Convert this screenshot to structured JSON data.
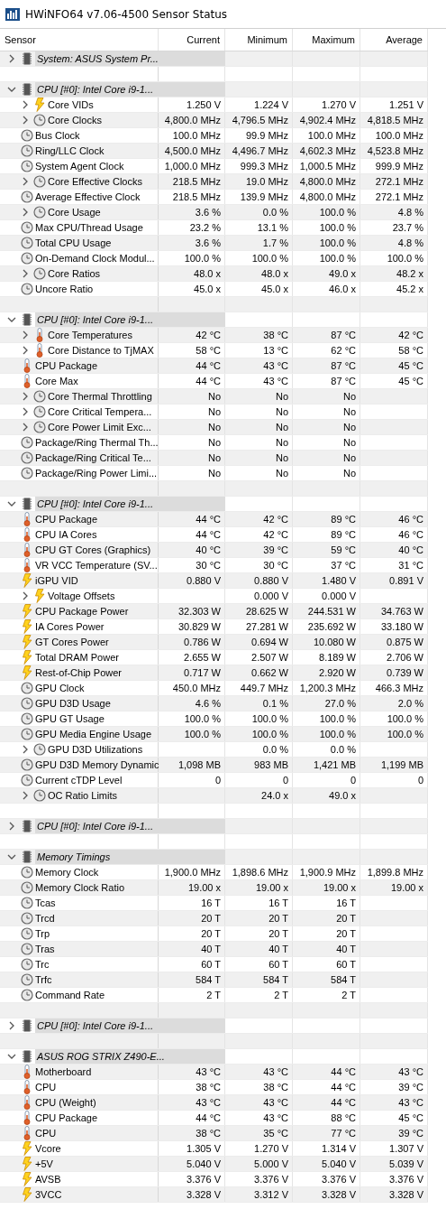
{
  "window": {
    "title": "HWiNFO64 v7.06-4500 Sensor Status"
  },
  "columns": [
    "Sensor",
    "Current",
    "Minimum",
    "Maximum",
    "Average"
  ],
  "groups": [
    {
      "label": "System: ASUS System Pr...",
      "expanded": false
    },
    {
      "label": "CPU [#0]: Intel Core i9-1...",
      "expanded": true,
      "rows": [
        {
          "name": "Core VIDs",
          "kind": "voltage",
          "expandable": true,
          "current": "1.250 V",
          "minimum": "1.224 V",
          "maximum": "1.270 V",
          "average": "1.251 V"
        },
        {
          "name": "Core Clocks",
          "kind": "clock",
          "expandable": true,
          "current": "4,800.0 MHz",
          "minimum": "4,796.5 MHz",
          "maximum": "4,902.4 MHz",
          "average": "4,818.5 MHz"
        },
        {
          "name": "Bus Clock",
          "kind": "clock",
          "expandable": false,
          "current": "100.0 MHz",
          "minimum": "99.9 MHz",
          "maximum": "100.0 MHz",
          "average": "100.0 MHz"
        },
        {
          "name": "Ring/LLC Clock",
          "kind": "clock",
          "expandable": false,
          "current": "4,500.0 MHz",
          "minimum": "4,496.7 MHz",
          "maximum": "4,602.3 MHz",
          "average": "4,523.8 MHz"
        },
        {
          "name": "System Agent Clock",
          "kind": "clock",
          "expandable": false,
          "current": "1,000.0 MHz",
          "minimum": "999.3 MHz",
          "maximum": "1,000.5 MHz",
          "average": "999.9 MHz"
        },
        {
          "name": "Core Effective Clocks",
          "kind": "clock",
          "expandable": true,
          "current": "218.5 MHz",
          "minimum": "19.0 MHz",
          "maximum": "4,800.0 MHz",
          "average": "272.1 MHz"
        },
        {
          "name": "Average Effective Clock",
          "kind": "clock",
          "expandable": false,
          "current": "218.5 MHz",
          "minimum": "139.9 MHz",
          "maximum": "4,800.0 MHz",
          "average": "272.1 MHz"
        },
        {
          "name": "Core Usage",
          "kind": "clock",
          "expandable": true,
          "current": "3.6 %",
          "minimum": "0.0 %",
          "maximum": "100.0 %",
          "average": "4.8 %"
        },
        {
          "name": "Max CPU/Thread Usage",
          "kind": "clock",
          "expandable": false,
          "current": "23.2 %",
          "minimum": "13.1 %",
          "maximum": "100.0 %",
          "average": "23.7 %"
        },
        {
          "name": "Total CPU Usage",
          "kind": "clock",
          "expandable": false,
          "current": "3.6 %",
          "minimum": "1.7 %",
          "maximum": "100.0 %",
          "average": "4.8 %"
        },
        {
          "name": "On-Demand Clock Modul...",
          "kind": "clock",
          "expandable": false,
          "current": "100.0 %",
          "minimum": "100.0 %",
          "maximum": "100.0 %",
          "average": "100.0 %"
        },
        {
          "name": "Core Ratios",
          "kind": "clock",
          "expandable": true,
          "current": "48.0 x",
          "minimum": "48.0 x",
          "maximum": "49.0 x",
          "average": "48.2 x"
        },
        {
          "name": "Uncore Ratio",
          "kind": "clock",
          "expandable": false,
          "current": "45.0 x",
          "minimum": "45.0 x",
          "maximum": "46.0 x",
          "average": "45.2 x"
        }
      ]
    },
    {
      "label": "CPU [#0]: Intel Core i9-1...",
      "expanded": true,
      "rows": [
        {
          "name": "Core Temperatures",
          "kind": "temperature",
          "expandable": true,
          "current": "42 °C",
          "minimum": "38 °C",
          "maximum": "87 °C",
          "average": "42 °C"
        },
        {
          "name": "Core Distance to TjMAX",
          "kind": "temperature",
          "expandable": true,
          "current": "58 °C",
          "minimum": "13 °C",
          "maximum": "62 °C",
          "average": "58 °C"
        },
        {
          "name": "CPU Package",
          "kind": "temperature",
          "expandable": false,
          "current": "44 °C",
          "minimum": "43 °C",
          "maximum": "87 °C",
          "average": "45 °C"
        },
        {
          "name": "Core Max",
          "kind": "temperature",
          "expandable": false,
          "current": "44 °C",
          "minimum": "43 °C",
          "maximum": "87 °C",
          "average": "45 °C"
        },
        {
          "name": "Core Thermal Throttling",
          "kind": "clock",
          "expandable": true,
          "current": "No",
          "minimum": "No",
          "maximum": "No"
        },
        {
          "name": "Core Critical Tempera...",
          "kind": "clock",
          "expandable": true,
          "current": "No",
          "minimum": "No",
          "maximum": "No"
        },
        {
          "name": "Core Power Limit Exc...",
          "kind": "clock",
          "expandable": true,
          "current": "No",
          "minimum": "No",
          "maximum": "No"
        },
        {
          "name": "Package/Ring Thermal Th...",
          "kind": "clock",
          "expandable": false,
          "current": "No",
          "minimum": "No",
          "maximum": "No"
        },
        {
          "name": "Package/Ring Critical Te...",
          "kind": "clock",
          "expandable": false,
          "current": "No",
          "minimum": "No",
          "maximum": "No"
        },
        {
          "name": "Package/Ring Power Limi...",
          "kind": "clock",
          "expandable": false,
          "current": "No",
          "minimum": "No",
          "maximum": "No"
        }
      ]
    },
    {
      "label": "CPU [#0]: Intel Core i9-1...",
      "expanded": true,
      "rows": [
        {
          "name": "CPU Package",
          "kind": "temperature",
          "expandable": false,
          "current": "44 °C",
          "minimum": "42 °C",
          "maximum": "89 °C",
          "average": "46 °C"
        },
        {
          "name": "CPU IA Cores",
          "kind": "temperature",
          "expandable": false,
          "current": "44 °C",
          "minimum": "42 °C",
          "maximum": "89 °C",
          "average": "46 °C"
        },
        {
          "name": "CPU GT Cores (Graphics)",
          "kind": "temperature",
          "expandable": false,
          "current": "40 °C",
          "minimum": "39 °C",
          "maximum": "59 °C",
          "average": "40 °C"
        },
        {
          "name": "VR VCC Temperature (SV...",
          "kind": "temperature",
          "expandable": false,
          "current": "30 °C",
          "minimum": "30 °C",
          "maximum": "37 °C",
          "average": "31 °C"
        },
        {
          "name": "iGPU VID",
          "kind": "voltage",
          "expandable": false,
          "current": "0.880 V",
          "minimum": "0.880 V",
          "maximum": "1.480 V",
          "average": "0.891 V"
        },
        {
          "name": "Voltage Offsets",
          "kind": "voltage",
          "expandable": true,
          "minimum": "0.000 V",
          "maximum": "0.000 V"
        },
        {
          "name": "CPU Package Power",
          "kind": "voltage",
          "expandable": false,
          "current": "32.303 W",
          "minimum": "28.625 W",
          "maximum": "244.531 W",
          "average": "34.763 W"
        },
        {
          "name": "IA Cores Power",
          "kind": "voltage",
          "expandable": false,
          "current": "30.829 W",
          "minimum": "27.281 W",
          "maximum": "235.692 W",
          "average": "33.180 W"
        },
        {
          "name": "GT Cores Power",
          "kind": "voltage",
          "expandable": false,
          "current": "0.786 W",
          "minimum": "0.694 W",
          "maximum": "10.080 W",
          "average": "0.875 W"
        },
        {
          "name": "Total DRAM Power",
          "kind": "voltage",
          "expandable": false,
          "current": "2.655 W",
          "minimum": "2.507 W",
          "maximum": "8.189 W",
          "average": "2.706 W"
        },
        {
          "name": "Rest-of-Chip Power",
          "kind": "voltage",
          "expandable": false,
          "current": "0.717 W",
          "minimum": "0.662 W",
          "maximum": "2.920 W",
          "average": "0.739 W"
        },
        {
          "name": "GPU Clock",
          "kind": "clock",
          "expandable": false,
          "current": "450.0 MHz",
          "minimum": "449.7 MHz",
          "maximum": "1,200.3 MHz",
          "average": "466.3 MHz"
        },
        {
          "name": "GPU D3D Usage",
          "kind": "clock",
          "expandable": false,
          "current": "4.6 %",
          "minimum": "0.1 %",
          "maximum": "27.0 %",
          "average": "2.0 %"
        },
        {
          "name": "GPU GT Usage",
          "kind": "clock",
          "expandable": false,
          "current": "100.0 %",
          "minimum": "100.0 %",
          "maximum": "100.0 %",
          "average": "100.0 %"
        },
        {
          "name": "GPU Media Engine Usage",
          "kind": "clock",
          "expandable": false,
          "current": "100.0 %",
          "minimum": "100.0 %",
          "maximum": "100.0 %",
          "average": "100.0 %"
        },
        {
          "name": "GPU D3D Utilizations",
          "kind": "clock",
          "expandable": true,
          "minimum": "0.0 %",
          "maximum": "0.0 %"
        },
        {
          "name": "GPU D3D Memory Dynamic",
          "kind": "clock",
          "expandable": false,
          "current": "1,098 MB",
          "minimum": "983 MB",
          "maximum": "1,421 MB",
          "average": "1,199 MB"
        },
        {
          "name": "Current cTDP Level",
          "kind": "clock",
          "expandable": false,
          "current": "0",
          "minimum": "0",
          "maximum": "0",
          "average": "0"
        },
        {
          "name": "OC Ratio Limits",
          "kind": "clock",
          "expandable": true,
          "minimum": "24.0 x",
          "maximum": "49.0 x"
        }
      ]
    },
    {
      "label": "CPU [#0]: Intel Core i9-1...",
      "expanded": false
    },
    {
      "label": "Memory Timings",
      "expanded": true,
      "rows": [
        {
          "name": "Memory Clock",
          "kind": "clock",
          "expandable": false,
          "current": "1,900.0 MHz",
          "minimum": "1,898.6 MHz",
          "maximum": "1,900.9 MHz",
          "average": "1,899.8 MHz"
        },
        {
          "name": "Memory Clock Ratio",
          "kind": "clock",
          "expandable": false,
          "current": "19.00 x",
          "minimum": "19.00 x",
          "maximum": "19.00 x",
          "average": "19.00 x"
        },
        {
          "name": "Tcas",
          "kind": "clock",
          "expandable": false,
          "current": "16 T",
          "minimum": "16 T",
          "maximum": "16 T"
        },
        {
          "name": "Trcd",
          "kind": "clock",
          "expandable": false,
          "current": "20 T",
          "minimum": "20 T",
          "maximum": "20 T"
        },
        {
          "name": "Trp",
          "kind": "clock",
          "expandable": false,
          "current": "20 T",
          "minimum": "20 T",
          "maximum": "20 T"
        },
        {
          "name": "Tras",
          "kind": "clock",
          "expandable": false,
          "current": "40 T",
          "minimum": "40 T",
          "maximum": "40 T"
        },
        {
          "name": "Trc",
          "kind": "clock",
          "expandable": false,
          "current": "60 T",
          "minimum": "60 T",
          "maximum": "60 T"
        },
        {
          "name": "Trfc",
          "kind": "clock",
          "expandable": false,
          "current": "584 T",
          "minimum": "584 T",
          "maximum": "584 T"
        },
        {
          "name": "Command Rate",
          "kind": "clock",
          "expandable": false,
          "current": "2 T",
          "minimum": "2 T",
          "maximum": "2 T"
        }
      ]
    },
    {
      "label": "CPU [#0]: Intel Core i9-1...",
      "expanded": false
    },
    {
      "label": "ASUS ROG STRIX Z490-E...",
      "expanded": true,
      "rows": [
        {
          "name": "Motherboard",
          "kind": "temperature",
          "expandable": false,
          "current": "43 °C",
          "minimum": "43 °C",
          "maximum": "44 °C",
          "average": "43 °C"
        },
        {
          "name": "CPU",
          "kind": "temperature",
          "expandable": false,
          "current": "38 °C",
          "minimum": "38 °C",
          "maximum": "44 °C",
          "average": "39 °C"
        },
        {
          "name": "CPU (Weight)",
          "kind": "temperature",
          "expandable": false,
          "current": "43 °C",
          "minimum": "43 °C",
          "maximum": "44 °C",
          "average": "43 °C"
        },
        {
          "name": "CPU Package",
          "kind": "temperature",
          "expandable": false,
          "current": "44 °C",
          "minimum": "43 °C",
          "maximum": "88 °C",
          "average": "45 °C"
        },
        {
          "name": "CPU",
          "kind": "temperature",
          "expandable": false,
          "current": "38 °C",
          "minimum": "35 °C",
          "maximum": "77 °C",
          "average": "39 °C"
        },
        {
          "name": "Vcore",
          "kind": "voltage",
          "expandable": false,
          "current": "1.305 V",
          "minimum": "1.270 V",
          "maximum": "1.314 V",
          "average": "1.307 V"
        },
        {
          "name": "+5V",
          "kind": "voltage",
          "expandable": false,
          "current": "5.040 V",
          "minimum": "5.000 V",
          "maximum": "5.040 V",
          "average": "5.039 V"
        },
        {
          "name": "AVSB",
          "kind": "voltage",
          "expandable": false,
          "current": "3.376 V",
          "minimum": "3.376 V",
          "maximum": "3.376 V",
          "average": "3.376 V"
        },
        {
          "name": "3VCC",
          "kind": "voltage",
          "expandable": false,
          "current": "3.328 V",
          "minimum": "3.312 V",
          "maximum": "3.328 V",
          "average": "3.328 V"
        }
      ]
    }
  ]
}
